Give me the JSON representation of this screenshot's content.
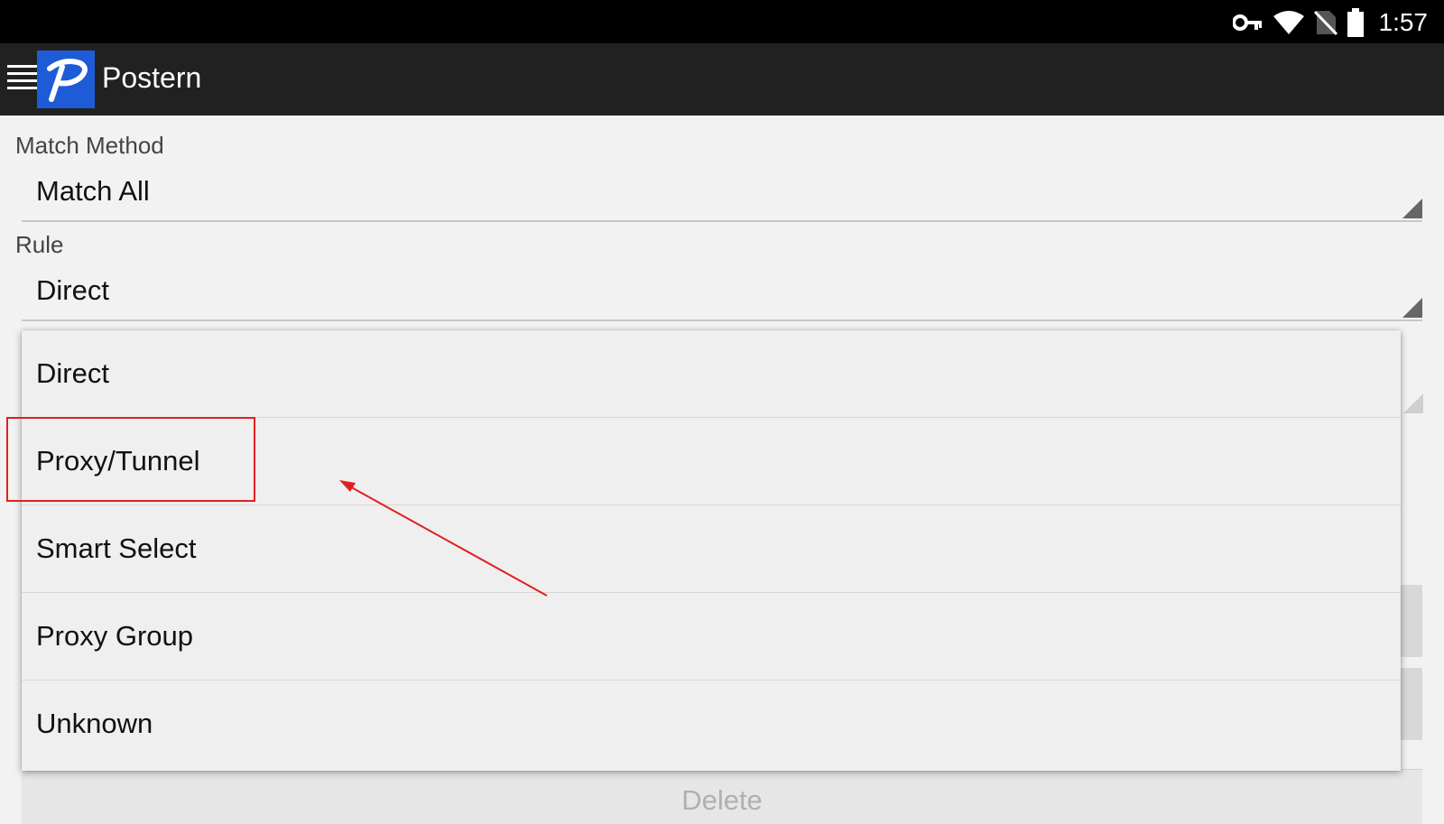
{
  "status_bar": {
    "time": "1:57",
    "icons": [
      "vpn-key-icon",
      "wifi-icon",
      "no-sim-icon",
      "battery-icon"
    ]
  },
  "app_bar": {
    "title": "Postern",
    "logo_letter": "P",
    "menu_icon": "hamburger-menu-icon"
  },
  "form": {
    "match_method": {
      "label": "Match Method",
      "value": "Match All"
    },
    "rule": {
      "label": "Rule",
      "value": "Direct"
    },
    "delete_label": "Delete"
  },
  "dropdown": {
    "options": [
      {
        "label": "Direct"
      },
      {
        "label": "Proxy/Tunnel"
      },
      {
        "label": "Smart Select"
      },
      {
        "label": "Proxy Group"
      },
      {
        "label": "Unknown"
      }
    ]
  },
  "annotation": {
    "highlight_color": "#e02020",
    "highlighted_option": "Proxy/Tunnel"
  },
  "colors": {
    "status_bar_bg": "#000000",
    "app_bar_bg": "#212121",
    "logo_bg": "#1e5bd7",
    "content_bg": "#f2f2f2"
  }
}
